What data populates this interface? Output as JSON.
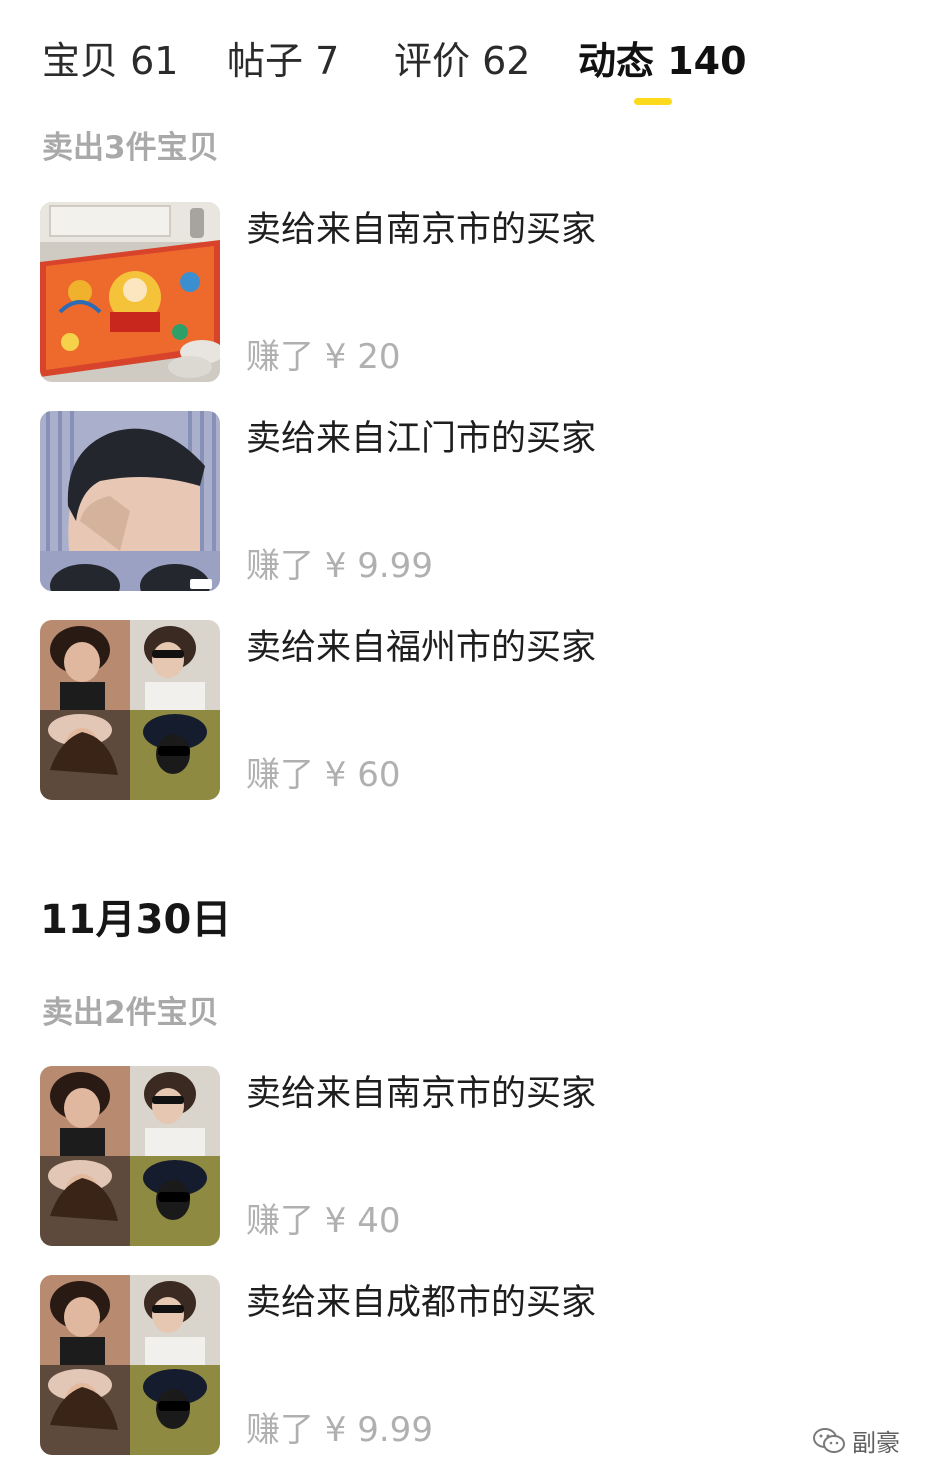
{
  "colors": {
    "accent": "#ffd91c",
    "muted": "#a9a9a9",
    "text": "#1e1e1e"
  },
  "tabs": [
    {
      "label": "宝贝 61",
      "active": false
    },
    {
      "label": "帖子 7",
      "active": false
    },
    {
      "label": "评价 62",
      "active": false
    },
    {
      "label": "动态 140",
      "active": true
    }
  ],
  "groups": [
    {
      "date": "",
      "summary": "卖出3件宝贝",
      "items": [
        {
          "title": "卖给来自南京市的买家",
          "earned": "赚了 ¥ 20",
          "thumb": "doormat-image"
        },
        {
          "title": "卖给来自江门市的买家",
          "earned": "赚了 ¥ 9.99",
          "thumb": "haircut-image"
        },
        {
          "title": "卖给来自福州市的买家",
          "earned": "赚了 ¥ 60",
          "thumb": "portrait-collage-image"
        }
      ]
    },
    {
      "date": "11月30日",
      "summary": "卖出2件宝贝",
      "items": [
        {
          "title": "卖给来自南京市的买家",
          "earned": "赚了 ¥ 40",
          "thumb": "portrait-collage-image"
        },
        {
          "title": "卖给来自成都市的买家",
          "earned": "赚了 ¥ 9.99",
          "thumb": "portrait-collage-image"
        }
      ]
    }
  ],
  "watermark": {
    "text": "副豪",
    "icon": "wechat-icon"
  }
}
